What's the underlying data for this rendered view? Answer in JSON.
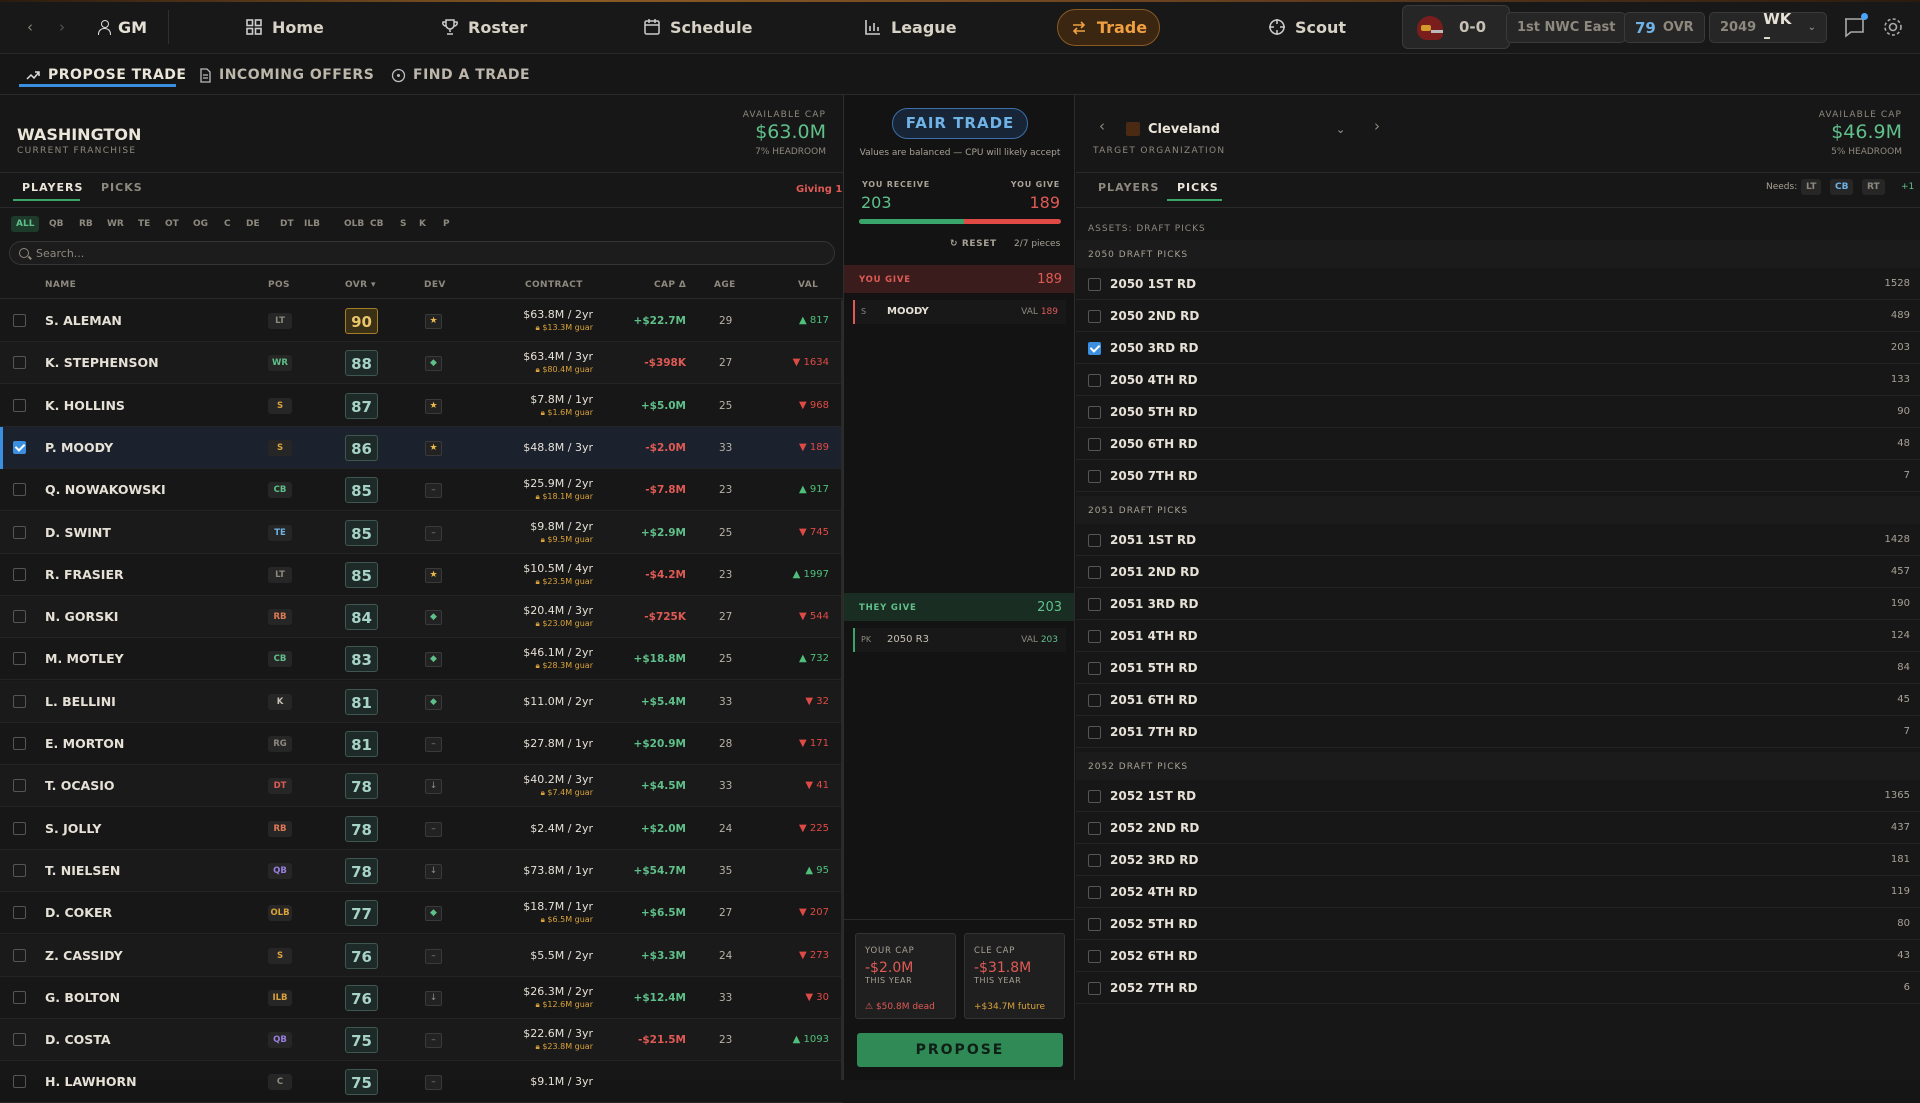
{
  "topbar": {
    "gm": "GM",
    "nav": [
      {
        "label": "Home",
        "icon": "home-icon"
      },
      {
        "label": "Roster",
        "icon": "trophy-icon"
      },
      {
        "label": "Schedule",
        "icon": "calendar-icon"
      },
      {
        "label": "League",
        "icon": "bar-chart-icon"
      },
      {
        "label": "Trade",
        "icon": "swap-icon",
        "active": true
      },
      {
        "label": "Scout",
        "icon": "crosshair-icon"
      }
    ],
    "record": "0-0",
    "standing": "1st NWC East",
    "ovr_value": "79",
    "ovr_label": "OVR",
    "year": "2049",
    "week": "WK –"
  },
  "subtabs": [
    {
      "label": "PROPOSE TRADE",
      "icon": "trend-up-icon",
      "active": true
    },
    {
      "label": "INCOMING OFFERS",
      "icon": "document-icon"
    },
    {
      "label": "FIND A TRADE",
      "icon": "target-icon"
    }
  ],
  "left": {
    "team": "WASHINGTON",
    "team_sub": "CURRENT FRANCHISE",
    "cap_label": "AVAILABLE CAP",
    "cap_value": "$63.0M",
    "cap_sub": "7% HEADROOM",
    "tabs": [
      "PLAYERS",
      "PICKS"
    ],
    "giving": "Giving 1",
    "positions": [
      "ALL",
      "QB",
      "RB",
      "WR",
      "TE",
      "OT",
      "OG",
      "C",
      "DE",
      "DT",
      "ILB",
      "OLB",
      "CB",
      "S",
      "K",
      "P"
    ],
    "search_placeholder": "Search...",
    "columns": [
      "NAME",
      "POS",
      "OVR ▾",
      "DEV",
      "CONTRACT",
      "CAP Δ",
      "AGE",
      "VAL"
    ],
    "players": [
      {
        "name": "S. ALEMAN",
        "pos": "LT",
        "ovr": "90",
        "dev": "★",
        "contract": "$63.8M / 2yr",
        "guar": "$13.3M guar",
        "cap": "+$22.7M",
        "age": "29",
        "val": "▲ 817"
      },
      {
        "name": "K. STEPHENSON",
        "pos": "WR",
        "ovr": "88",
        "dev": "◆",
        "contract": "$63.4M / 3yr",
        "guar": "$80.4M guar",
        "cap": "-$398K",
        "age": "27",
        "val": "▼ 1634"
      },
      {
        "name": "K. HOLLINS",
        "pos": "S",
        "ovr": "87",
        "dev": "★",
        "contract": "$7.8M / 1yr",
        "guar": "$1.6M guar",
        "cap": "+$5.0M",
        "age": "25",
        "val": "▼ 968"
      },
      {
        "name": "P. MOODY",
        "pos": "S",
        "ovr": "86",
        "dev": "★",
        "contract": "$48.8M / 3yr",
        "guar": "",
        "cap": "-$2.0M",
        "age": "33",
        "val": "▼ 189",
        "selected": true
      },
      {
        "name": "Q. NOWAKOWSKI",
        "pos": "CB",
        "ovr": "85",
        "dev": "–",
        "contract": "$25.9M / 2yr",
        "guar": "$18.1M guar",
        "cap": "-$7.8M",
        "age": "23",
        "val": "▲ 917"
      },
      {
        "name": "D. SWINT",
        "pos": "TE",
        "ovr": "85",
        "dev": "–",
        "contract": "$9.8M / 2yr",
        "guar": "$9.5M guar",
        "cap": "+$2.9M",
        "age": "25",
        "val": "▼ 745"
      },
      {
        "name": "R. FRASIER",
        "pos": "LT",
        "ovr": "85",
        "dev": "★",
        "contract": "$10.5M / 4yr",
        "guar": "$23.5M guar",
        "cap": "-$4.2M",
        "age": "23",
        "val": "▲ 1997"
      },
      {
        "name": "N. GORSKI",
        "pos": "RB",
        "ovr": "84",
        "dev": "◆",
        "contract": "$20.4M / 3yr",
        "guar": "$23.0M guar",
        "cap": "-$725K",
        "age": "27",
        "val": "▼ 544"
      },
      {
        "name": "M. MOTLEY",
        "pos": "CB",
        "ovr": "83",
        "dev": "◆",
        "contract": "$46.1M / 2yr",
        "guar": "$28.3M guar",
        "cap": "+$18.8M",
        "age": "25",
        "val": "▲ 732"
      },
      {
        "name": "L. BELLINI",
        "pos": "K",
        "ovr": "81",
        "dev": "◆",
        "contract": "$11.0M / 2yr",
        "guar": "",
        "cap": "+$5.4M",
        "age": "33",
        "val": "▼ 32"
      },
      {
        "name": "E. MORTON",
        "pos": "RG",
        "ovr": "81",
        "dev": "–",
        "contract": "$27.8M / 1yr",
        "guar": "",
        "cap": "+$20.9M",
        "age": "28",
        "val": "▼ 171"
      },
      {
        "name": "T. OCASIO",
        "pos": "DT",
        "ovr": "78",
        "dev": "↓",
        "contract": "$40.2M / 3yr",
        "guar": "$7.4M guar",
        "cap": "+$4.5M",
        "age": "33",
        "val": "▼ 41"
      },
      {
        "name": "S. JOLLY",
        "pos": "RB",
        "ovr": "78",
        "dev": "–",
        "contract": "$2.4M / 2yr",
        "guar": "",
        "cap": "+$2.0M",
        "age": "24",
        "val": "▼ 225"
      },
      {
        "name": "T. NIELSEN",
        "pos": "QB",
        "ovr": "78",
        "dev": "↓",
        "contract": "$73.8M / 1yr",
        "guar": "",
        "cap": "+$54.7M",
        "age": "35",
        "val": "▲ 95"
      },
      {
        "name": "D. COKER",
        "pos": "OLB",
        "ovr": "77",
        "dev": "◆",
        "contract": "$18.7M / 1yr",
        "guar": "$6.5M guar",
        "cap": "+$6.5M",
        "age": "27",
        "val": "▼ 207"
      },
      {
        "name": "Z. CASSIDY",
        "pos": "S",
        "ovr": "76",
        "dev": "–",
        "contract": "$5.5M / 2yr",
        "guar": "",
        "cap": "+$3.3M",
        "age": "24",
        "val": "▼ 273"
      },
      {
        "name": "G. BOLTON",
        "pos": "ILB",
        "ovr": "76",
        "dev": "↓",
        "contract": "$26.3M / 2yr",
        "guar": "$12.6M guar",
        "cap": "+$12.4M",
        "age": "33",
        "val": "▼ 30"
      },
      {
        "name": "D. COSTA",
        "pos": "QB",
        "ovr": "75",
        "dev": "–",
        "contract": "$22.6M / 3yr",
        "guar": "$23.8M guar",
        "cap": "-$21.5M",
        "age": "23",
        "val": "▲ 1093"
      },
      {
        "name": "H. LAWHORN",
        "pos": "C",
        "ovr": "75",
        "dev": "–",
        "contract": "$9.1M / 3yr",
        "guar": "",
        "cap": "",
        "age": "",
        "val": ""
      }
    ]
  },
  "middle": {
    "verdict": "FAIR TRADE",
    "verdict_sub": "Values are balanced — CPU will likely accept",
    "receive_label": "YOU RECEIVE",
    "receive_value": "203",
    "give_label": "YOU GIVE",
    "give_value": "189",
    "receive_share": 0.518,
    "reset": "RESET",
    "pieces": "2/7 pieces",
    "you_give_header": "YOU GIVE",
    "you_give_total": "189",
    "give_assets": [
      {
        "pos": "S",
        "name": "MOODY",
        "val_label": "VAL",
        "val": "189"
      }
    ],
    "they_give_header": "THEY GIVE",
    "they_give_total": "203",
    "they_assets": [
      {
        "pos": "PK",
        "name": "2050 R3",
        "val_label": "VAL",
        "val": "203"
      }
    ],
    "your_cap": {
      "label": "YOUR CAP",
      "value": "-$2.0M",
      "sub": "THIS YEAR",
      "foot": "$50.8M dead"
    },
    "cle_cap": {
      "label": "CLE CAP",
      "value": "-$31.8M",
      "sub": "THIS YEAR",
      "foot": "+$34.7M future"
    },
    "propose": "PROPOSE"
  },
  "right": {
    "org": "Cleveland",
    "org_sub": "TARGET ORGANIZATION",
    "cap_label": "AVAILABLE CAP",
    "cap_value": "$46.9M",
    "cap_sub": "5% HEADROOM",
    "tabs": [
      "PLAYERS",
      "PICKS"
    ],
    "needs_label": "Needs:",
    "needs": [
      "LT",
      "CB",
      "RT"
    ],
    "needs_more": "+1",
    "section": "ASSETS: DRAFT PICKS",
    "years": [
      {
        "header": "2050 DRAFT PICKS",
        "picks": [
          {
            "name": "2050 1ST RD",
            "val": "1528"
          },
          {
            "name": "2050 2ND RD",
            "val": "489"
          },
          {
            "name": "2050 3RD RD",
            "val": "203",
            "checked": true
          },
          {
            "name": "2050 4TH RD",
            "val": "133"
          },
          {
            "name": "2050 5TH RD",
            "val": "90"
          },
          {
            "name": "2050 6TH RD",
            "val": "48"
          },
          {
            "name": "2050 7TH RD",
            "val": "7"
          }
        ]
      },
      {
        "header": "2051 DRAFT PICKS",
        "picks": [
          {
            "name": "2051 1ST RD",
            "val": "1428"
          },
          {
            "name": "2051 2ND RD",
            "val": "457"
          },
          {
            "name": "2051 3RD RD",
            "val": "190"
          },
          {
            "name": "2051 4TH RD",
            "val": "124"
          },
          {
            "name": "2051 5TH RD",
            "val": "84"
          },
          {
            "name": "2051 6TH RD",
            "val": "45"
          },
          {
            "name": "2051 7TH RD",
            "val": "7"
          }
        ]
      },
      {
        "header": "2052 DRAFT PICKS",
        "picks": [
          {
            "name": "2052 1ST RD",
            "val": "1365"
          },
          {
            "name": "2052 2ND RD",
            "val": "437"
          },
          {
            "name": "2052 3RD RD",
            "val": "181"
          },
          {
            "name": "2052 4TH RD",
            "val": "119"
          },
          {
            "name": "2052 5TH RD",
            "val": "80"
          },
          {
            "name": "2052 6TH RD",
            "val": "43"
          },
          {
            "name": "2052 7TH RD",
            "val": "6"
          }
        ]
      }
    ]
  },
  "colors": {
    "accent": "#f0a040",
    "positive": "#5fc08a",
    "negative": "#e05a55",
    "select": "#3a8fe0"
  }
}
